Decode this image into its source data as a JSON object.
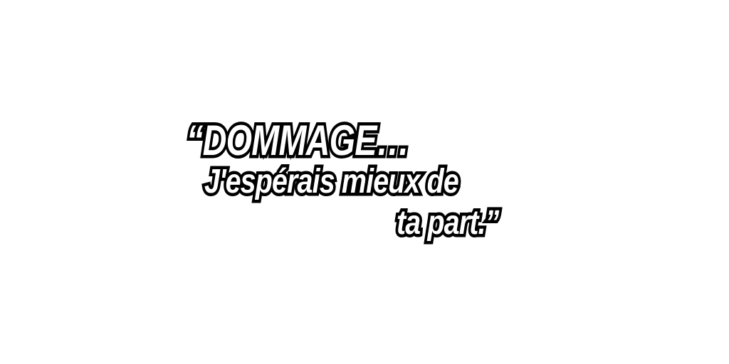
{
  "quote": {
    "line1": "“DOMMAGE…",
    "line2": "J'espérais mieux de",
    "line3": "ta part.”"
  }
}
